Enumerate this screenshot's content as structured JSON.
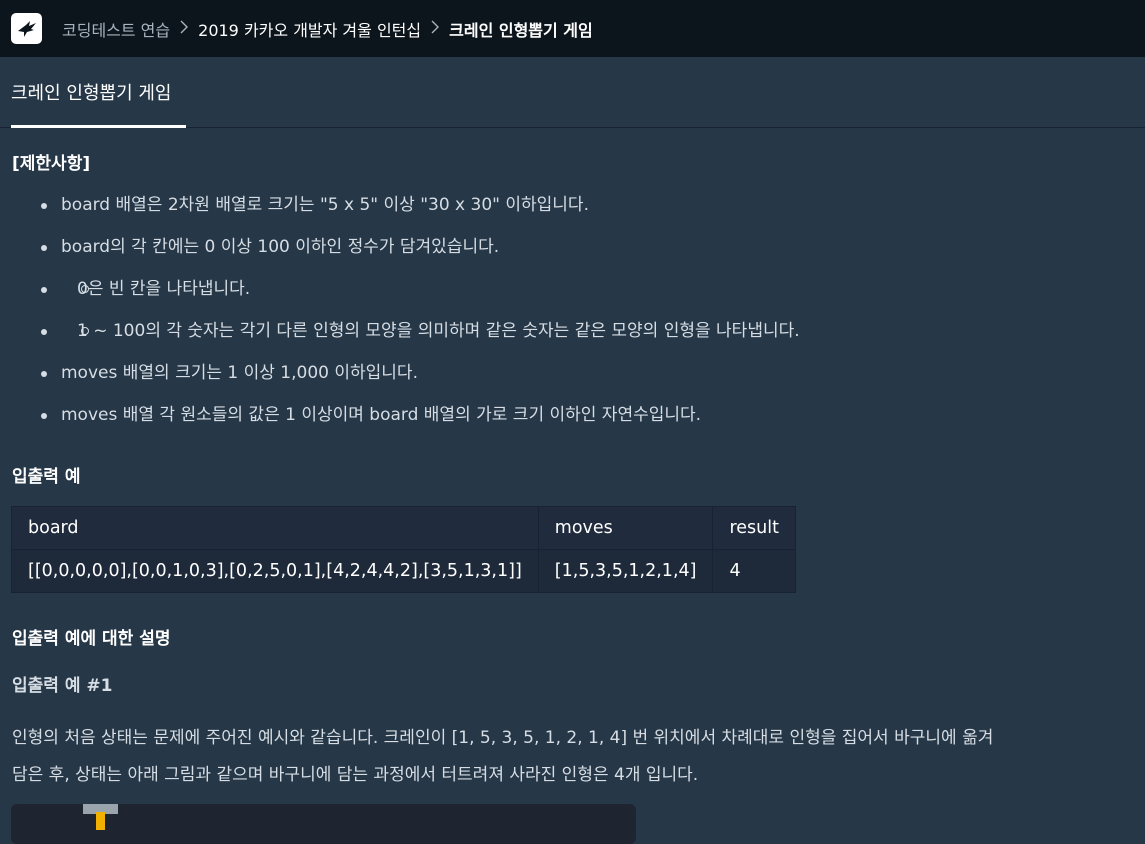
{
  "breadcrumb": {
    "item1": "코딩테스트 연습",
    "item2": "2019 카카오 개발자 겨울 인턴십",
    "item3": "크레인 인형뽑기 게임",
    "separator": ">"
  },
  "tab": {
    "label": "크레인 인형뽑기 게임"
  },
  "restrictions": {
    "title": "[제한사항]",
    "items": [
      "board 배열은 2차원 배열로 크기는 \"5 x 5\" 이상 \"30 x 30\" 이하입니다.",
      "board의 각 칸에는 0 이상 100 이하인 정수가 담겨있습니다.",
      "moves 배열의 크기는 1 이상 1,000 이하입니다.",
      "moves 배열 각 원소들의 값은 1 이상이며 board 배열의 가로 크기 이하인 자연수입니다."
    ],
    "subitems": [
      "0은 빈 칸을 나타냅니다.",
      "1 ~ 100의 각 숫자는 각기 다른 인형의 모양을 의미하며 같은 숫자는 같은 모양의 인형을 나타냅니다."
    ]
  },
  "example": {
    "title": "입출력 예",
    "headers": [
      "board",
      "moves",
      "result"
    ],
    "rows": [
      [
        "[[0,0,0,0,0],[0,0,1,0,3],[0,2,5,0,1],[4,2,4,4,2],[3,5,1,3,1]]",
        "[1,5,3,5,1,2,1,4]",
        "4"
      ]
    ]
  },
  "explanation": {
    "title": "입출력 예에 대한 설명",
    "subtitle": "입출력 예 #1",
    "line1": "인형의 처음 상태는 문제에 주어진 예시와 같습니다. 크레인이 [1, 5, 3, 5, 1, 2, 1, 4] 번 위치에서 차례대로 인형을 집어서 바구니에 옮겨",
    "line2": "담은 후, 상태는 아래 그림과 같으며 바구니에 담는 과정에서 터트려져 사라진 인형은 4개 입니다."
  }
}
